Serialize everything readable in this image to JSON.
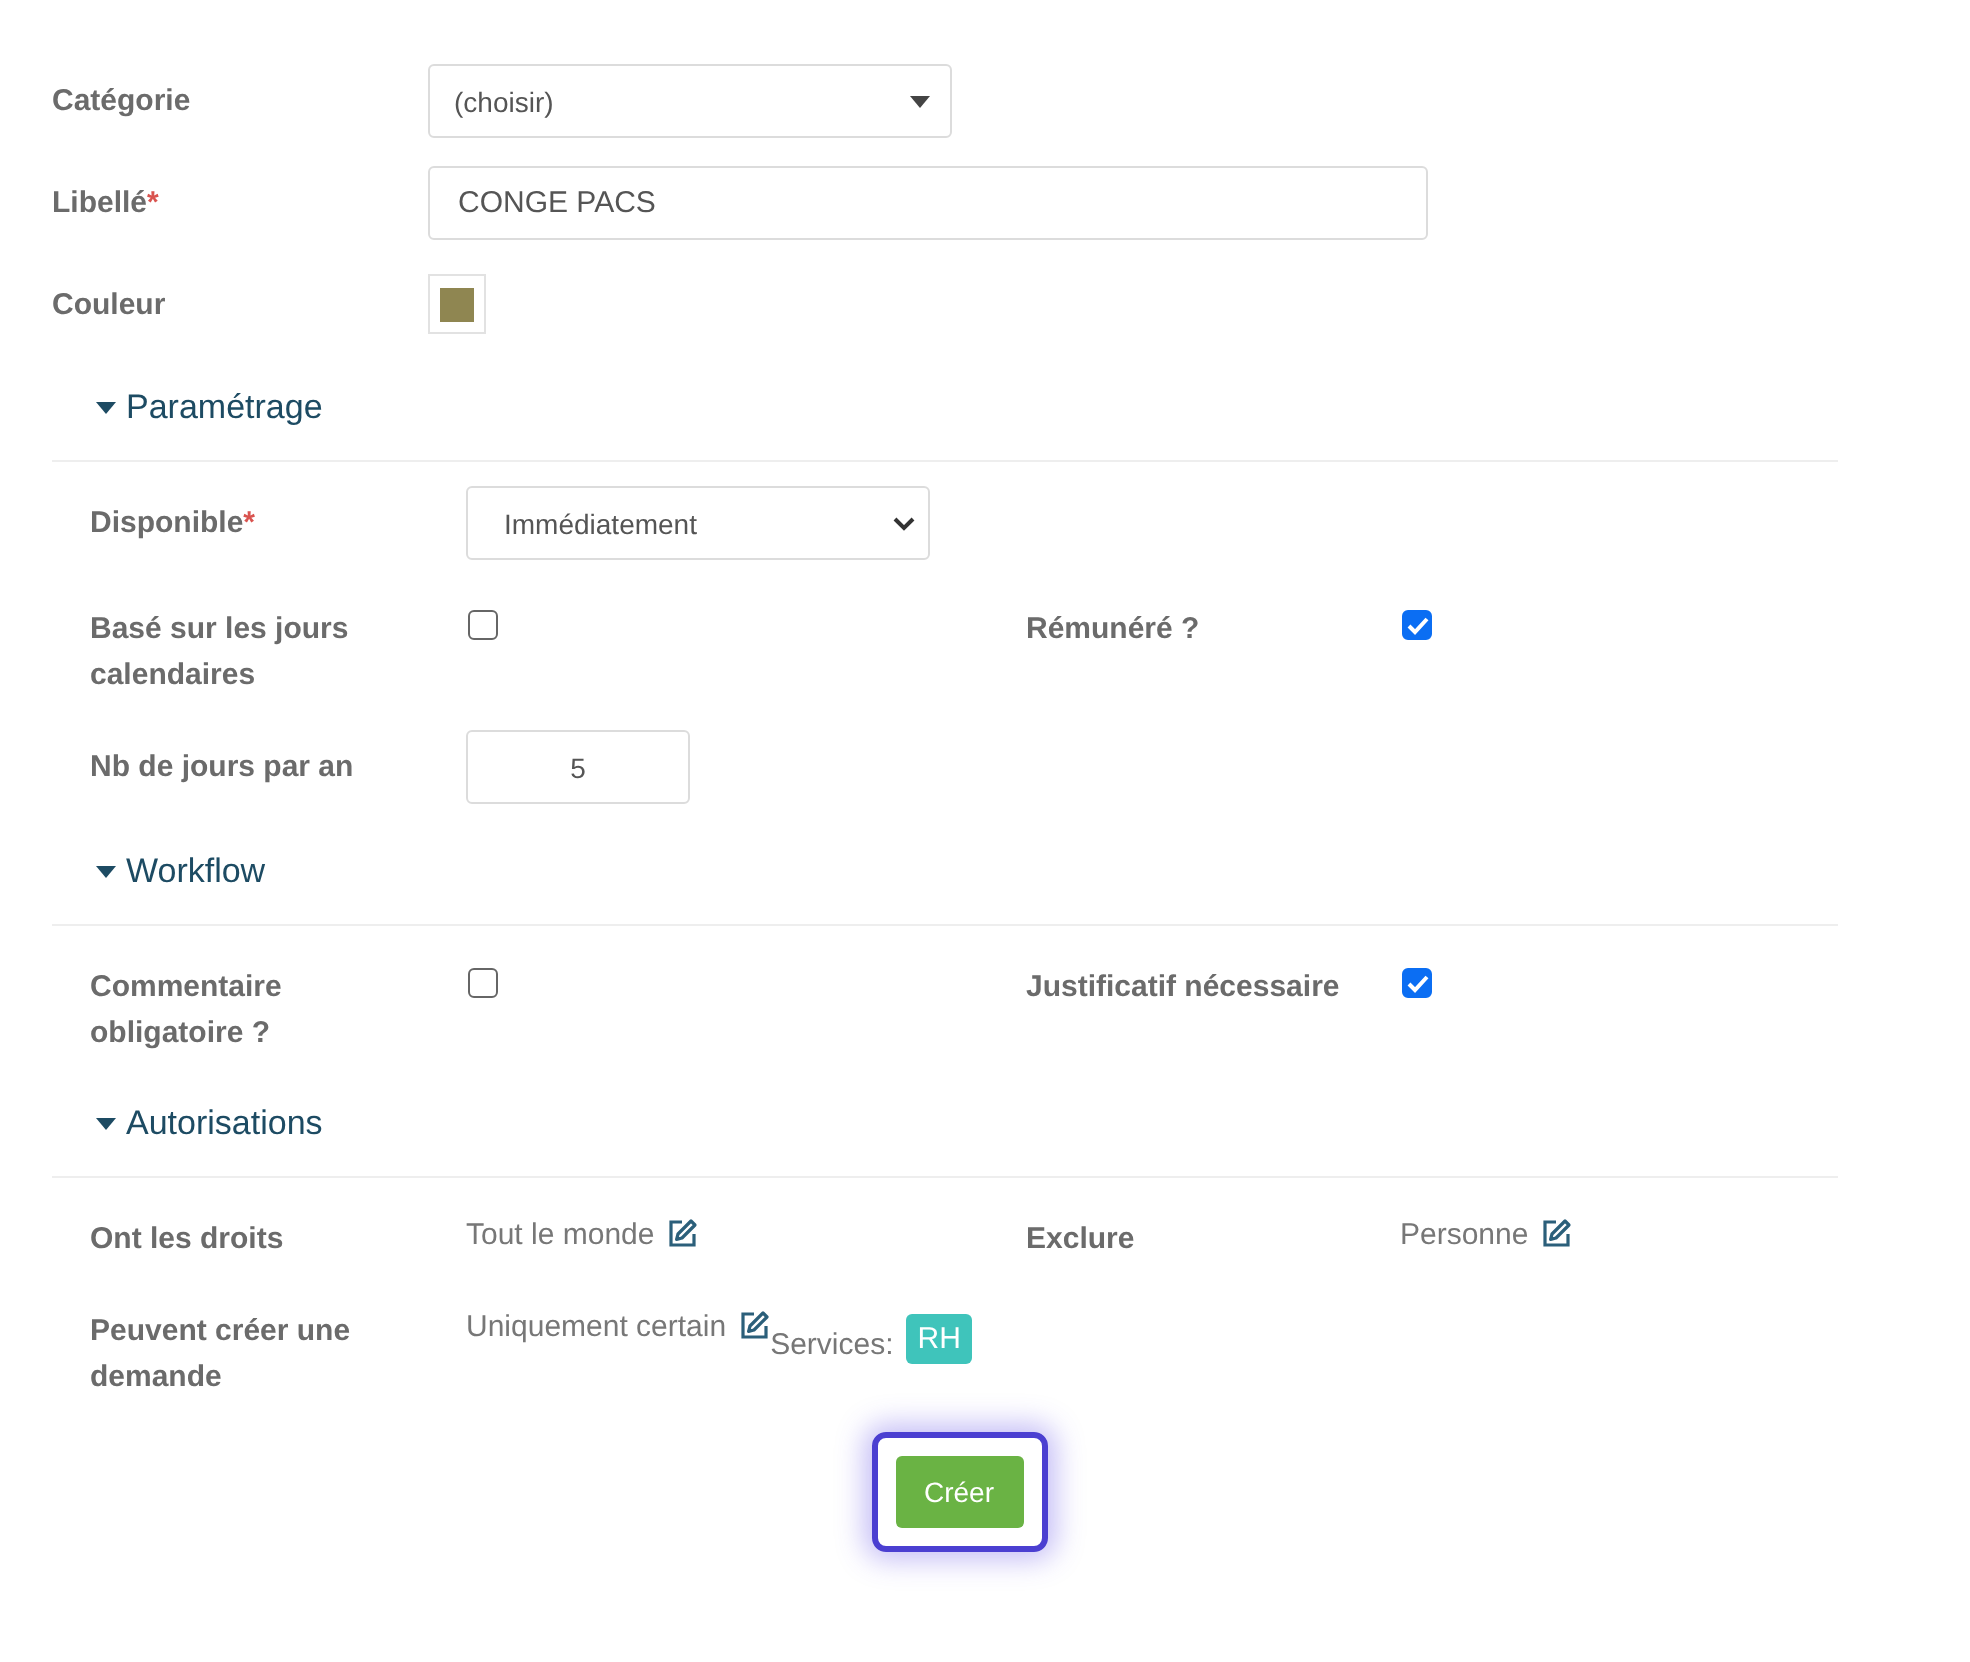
{
  "fields": [
    {
      "label": "Catégorie",
      "kind": "dropdown",
      "value": "(choisir)"
    },
    {
      "label": "Libellé",
      "required_mark": "*",
      "kind": "text",
      "value": "CONGE PACS"
    },
    {
      "label": "Couleur",
      "kind": "color",
      "color": "#8f8651"
    }
  ],
  "sections": [
    {
      "title": "Paramétrage",
      "expanded": true,
      "rows": [
        [
          {
            "label": "Disponible",
            "required_mark": "*",
            "kind": "select",
            "value": "Immédiatement"
          }
        ],
        [
          {
            "label": "Basé sur les jours calendaires",
            "kind": "checkbox",
            "checked": false
          },
          {
            "label": "Rémunéré ?",
            "kind": "checkbox",
            "checked": true
          }
        ],
        [
          {
            "label": "Nb de jours par an",
            "kind": "number",
            "value": "5"
          }
        ]
      ]
    },
    {
      "title": "Workflow",
      "expanded": true,
      "rows": [
        [
          {
            "label": "Commentaire obligatoire ?",
            "kind": "checkbox",
            "checked": false
          },
          {
            "label": "Justificatif nécessaire",
            "kind": "checkbox",
            "checked": true
          }
        ]
      ]
    },
    {
      "title": "Autorisations",
      "expanded": true,
      "rows": [
        [
          {
            "label": "Ont les droits",
            "kind": "link",
            "value": "Tout le monde"
          },
          {
            "label": "Exclure",
            "kind": "link",
            "value": "Personne"
          }
        ],
        [
          {
            "label": "Peuvent créer une demande",
            "kind": "link",
            "value": "Uniquement certain",
            "extra_label": "Services:",
            "tags": [
              "RH"
            ]
          }
        ]
      ]
    }
  ],
  "submit": {
    "label": "Créer",
    "focused": true
  }
}
